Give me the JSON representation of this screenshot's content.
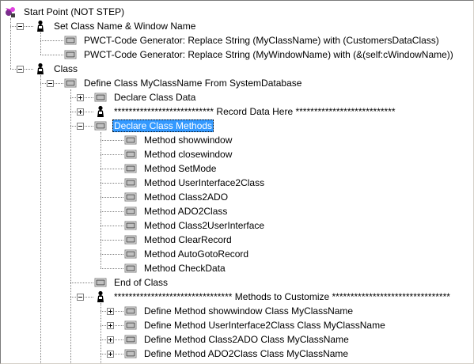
{
  "tree": {
    "nodes": [
      {
        "label": "Start Point (NOT STEP)",
        "icon": "start-icon",
        "depth": 0
      },
      {
        "label": "Set Class Name & Window Name",
        "icon": "person-icon",
        "depth": 1,
        "expander": "minus"
      },
      {
        "label": "PWCT-Code Generator: Replace String (MyClassName) with (CustomersDataClass)",
        "icon": "step-icon",
        "depth": 2
      },
      {
        "label": "PWCT-Code Generator: Replace String (MyWindowName) with (&(self:cWindowName))",
        "icon": "step-icon",
        "depth": 2
      },
      {
        "label": "Class",
        "icon": "person-icon",
        "depth": 1,
        "expander": "minus"
      },
      {
        "label": "Define Class MyClassName From SystemDatabase",
        "icon": "step-icon",
        "depth": 2,
        "expander": "minus"
      },
      {
        "label": "Declare Class Data",
        "icon": "step-icon",
        "depth": 3,
        "expander": "plus"
      },
      {
        "label": "*************************** Record Data Here ***************************",
        "icon": "person-icon",
        "depth": 3,
        "expander": "plus"
      },
      {
        "label": "Declare Class Methods",
        "icon": "step-icon",
        "depth": 3,
        "expander": "minus",
        "selected": true
      },
      {
        "label": "Method showwindow",
        "icon": "step-icon",
        "depth": 4
      },
      {
        "label": "Method closewindow",
        "icon": "step-icon",
        "depth": 4
      },
      {
        "label": "Method SetMode",
        "icon": "step-icon",
        "depth": 4
      },
      {
        "label": "Method UserInterface2Class",
        "icon": "step-icon",
        "depth": 4
      },
      {
        "label": "Method Class2ADO",
        "icon": "step-icon",
        "depth": 4
      },
      {
        "label": "Method ADO2Class",
        "icon": "step-icon",
        "depth": 4
      },
      {
        "label": "Method Class2UserInterface",
        "icon": "step-icon",
        "depth": 4
      },
      {
        "label": "Method ClearRecord",
        "icon": "step-icon",
        "depth": 4
      },
      {
        "label": "Method AutoGotoRecord",
        "icon": "step-icon",
        "depth": 4
      },
      {
        "label": "Method CheckData",
        "icon": "step-icon",
        "depth": 4
      },
      {
        "label": "End of Class",
        "icon": "step-icon",
        "depth": 3
      },
      {
        "label": "******************************** Methods to Customize ********************************",
        "icon": "person-icon",
        "depth": 3,
        "expander": "minus"
      },
      {
        "label": "Define Method showwindow Class MyClassName",
        "icon": "step-icon",
        "depth": 4,
        "expander": "plus"
      },
      {
        "label": "Define Method UserInterface2Class Class MyClassName",
        "icon": "step-icon",
        "depth": 4,
        "expander": "plus"
      },
      {
        "label": "Define Method Class2ADO Class MyClassName",
        "icon": "step-icon",
        "depth": 4,
        "expander": "plus"
      },
      {
        "label": "Define Method ADO2Class Class MyClassName",
        "icon": "step-icon",
        "depth": 4,
        "expander": "plus"
      }
    ]
  },
  "colors": {
    "selection": "#3399ff",
    "step_icon_fill": "#c0c0c0",
    "person_icon": "#000000"
  }
}
